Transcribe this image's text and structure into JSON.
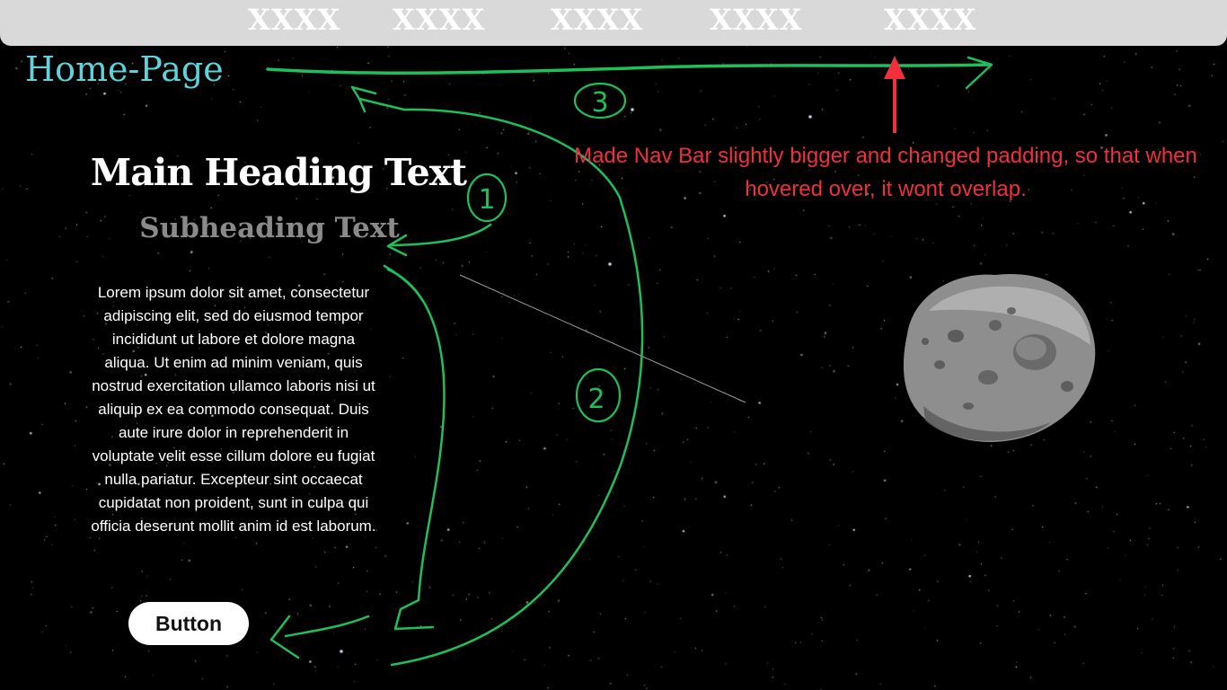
{
  "navbar": {
    "links": [
      "XXXX",
      "XXXX",
      "XXXX",
      "XXXX",
      "XXXX"
    ],
    "background_color": "#d9d9d9"
  },
  "logo": {
    "text": "Home-Page",
    "color": "#5fd3dc"
  },
  "hero": {
    "heading": "Main Heading Text",
    "subheading": "Subheading Text",
    "body": "Lorem ipsum dolor sit amet, consectetur adipiscing elit, sed do eiusmod tempor incididunt ut labore et dolore magna aliqua. Ut enim ad minim veniam, quis nostrud exercitation ullamco laboris nisi ut aliquip ex ea commodo consequat. Duis aute irure dolor in reprehenderit in voluptate velit esse cillum dolore eu fugiat nulla pariatur. Excepteur sint occaecat cupidatat non proident, sunt in culpa qui officia deserunt mollit anim id est laborum.",
    "button_label": "Button"
  },
  "annotations": {
    "note": "Made Nav Bar slightly bigger and changed padding, so that when hovered over, it wont overlap.",
    "note_color": "#f0303a",
    "markers": [
      "1",
      "2",
      "3"
    ],
    "stroke_color": "#1fbf5a"
  },
  "scene": {
    "background_color": "#000000",
    "decorations": [
      "starfield",
      "asteroid",
      "shooting-star"
    ]
  }
}
